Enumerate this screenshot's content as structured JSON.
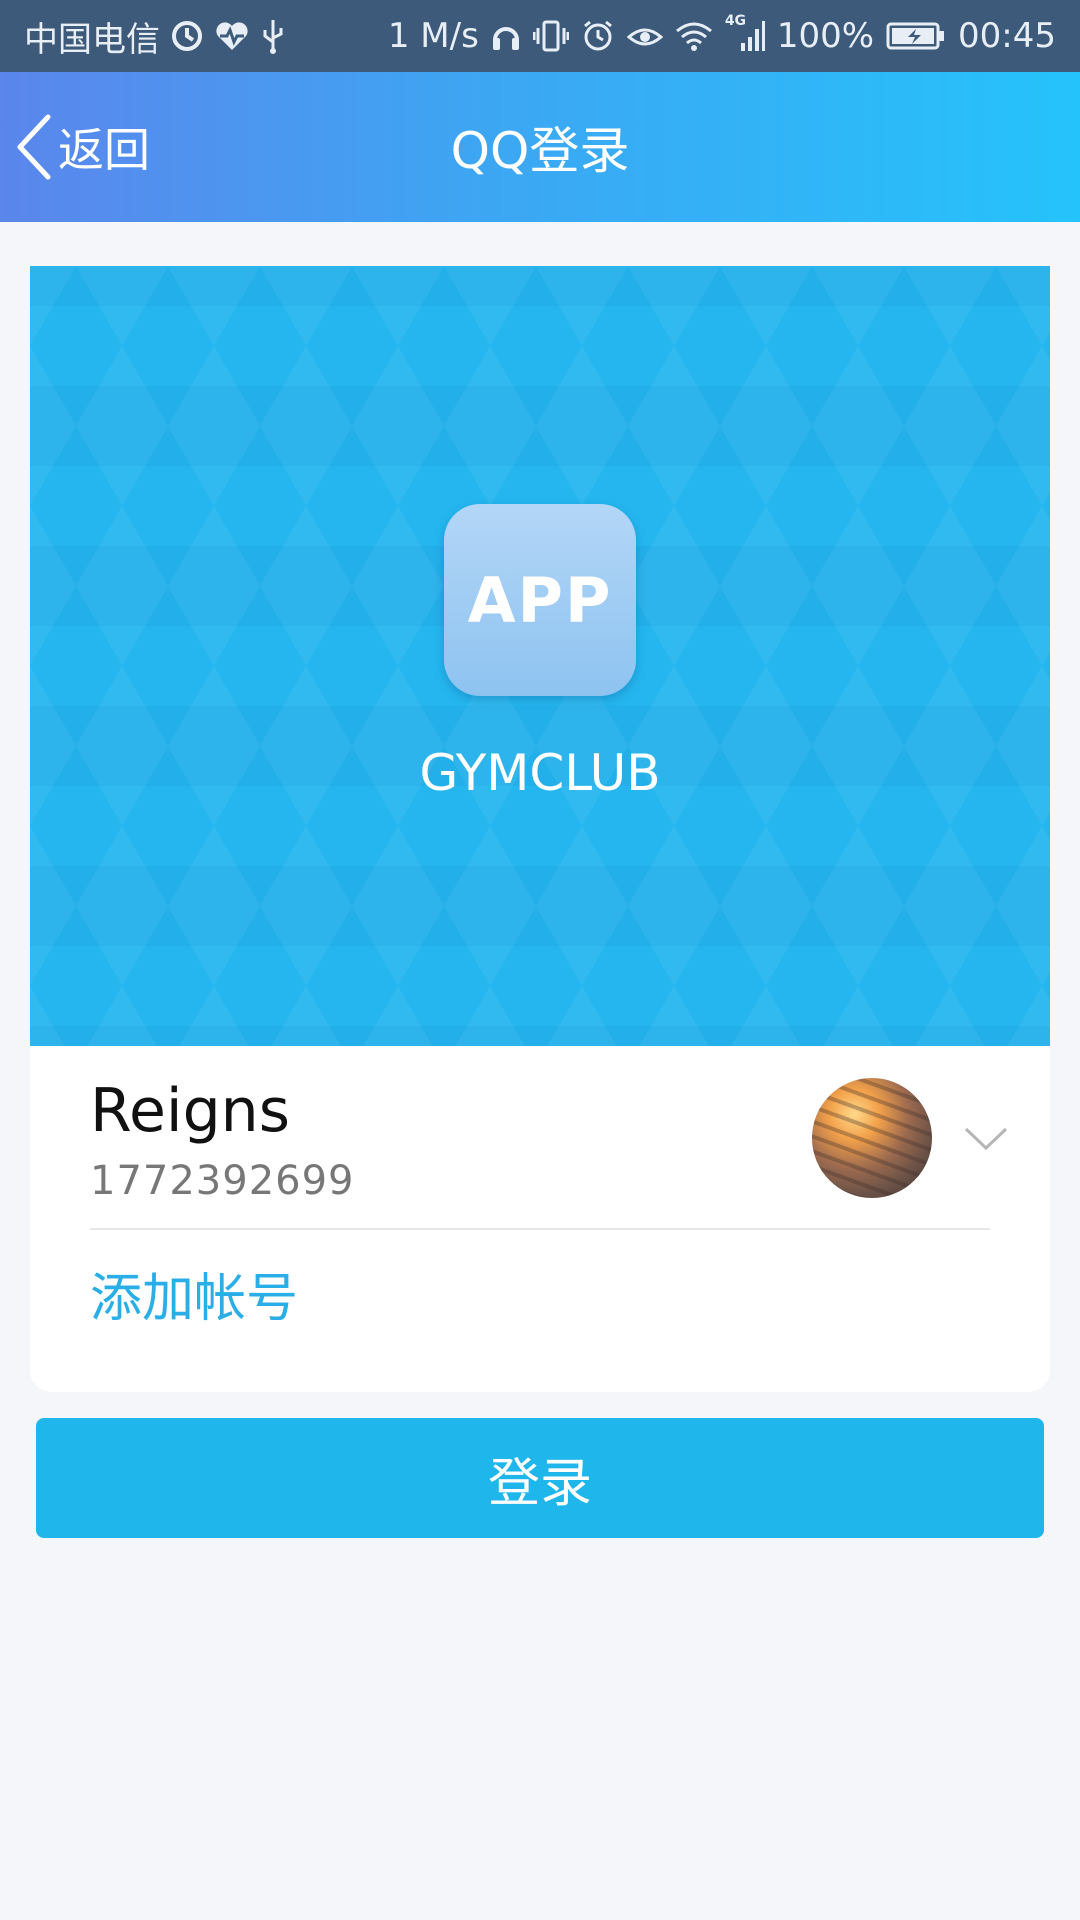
{
  "status_bar": {
    "carrier": "中国电信",
    "speed": "1 M/s",
    "network": "4G",
    "battery": "100%",
    "time": "00:45",
    "icons": [
      "sync-icon",
      "health-icon",
      "usb-icon",
      "headset-icon",
      "vibrate-icon",
      "alarm-icon",
      "eye-icon",
      "wifi-icon",
      "signal-icon",
      "battery-icon"
    ]
  },
  "nav": {
    "back_label": "返回",
    "title": "QQ登录"
  },
  "banner": {
    "app_icon_text": "APP",
    "app_name": "GYMCLUB",
    "background_color": "#25b6ef"
  },
  "account": {
    "name": "Reigns",
    "number": "1772392699"
  },
  "add_account_label": "添加帐号",
  "login_label": "登录",
  "colors": {
    "accent": "#1fb6ec",
    "link": "#2aaee8"
  }
}
